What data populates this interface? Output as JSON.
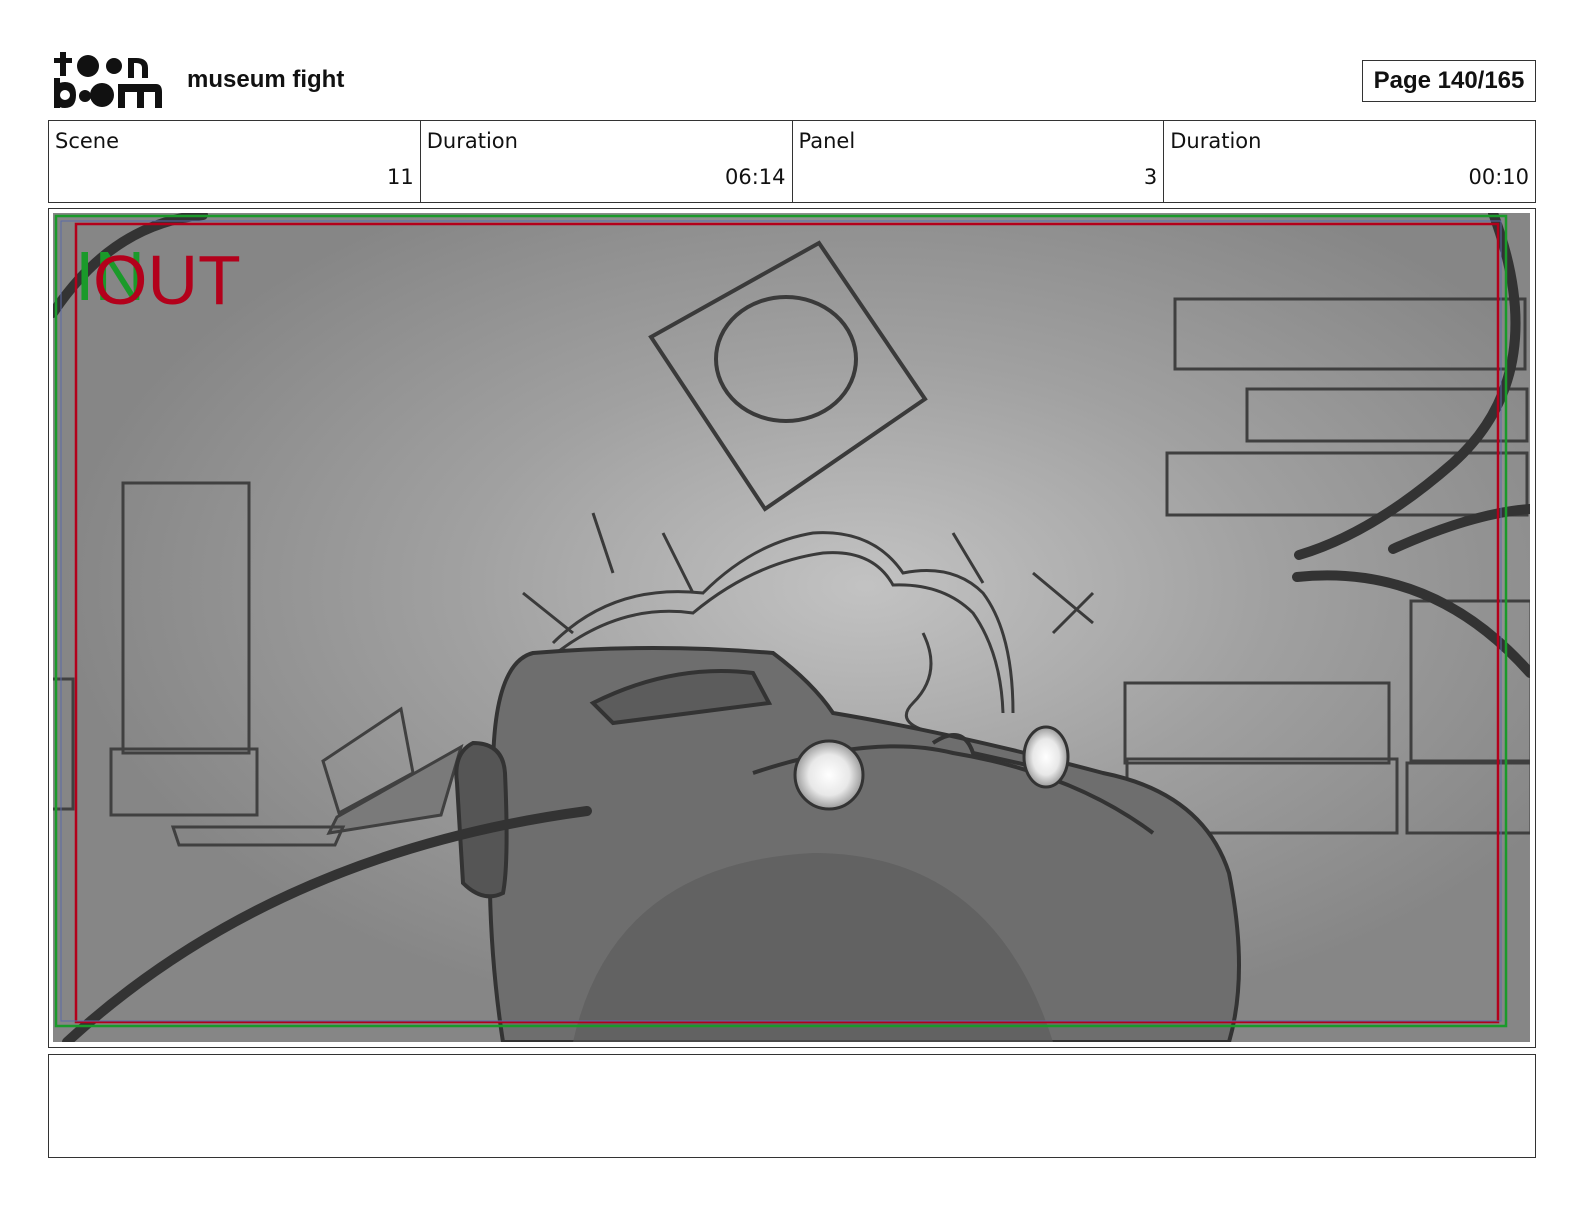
{
  "header": {
    "logo_text": "toon boom",
    "title": "museum fight",
    "page_label": "Page 140/165"
  },
  "info": {
    "scene_label": "Scene",
    "scene_value": "11",
    "scene_duration_label": "Duration",
    "scene_duration_value": "06:14",
    "panel_label": "Panel",
    "panel_value": "3",
    "panel_duration_label": "Duration",
    "panel_duration_value": "00:10"
  },
  "panel": {
    "in_marker": "IN",
    "out_marker": "OUT",
    "colors": {
      "background": "#8a8a8a",
      "safe_red": "#b3001b",
      "safe_green": "#1a9a2a",
      "sketch": "#3a3a3a"
    }
  },
  "notes": {
    "text": ""
  }
}
